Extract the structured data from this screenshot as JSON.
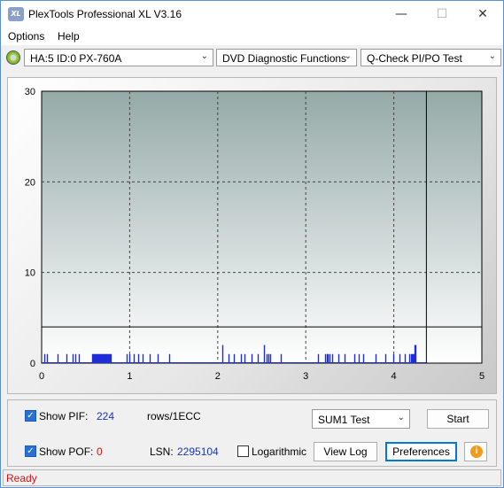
{
  "window": {
    "title": "PlexTools Professional XL V3.16",
    "icon_text": "XL",
    "minimize_glyph": "—",
    "maximize_glyph": "☐",
    "close_glyph": "✕"
  },
  "menu": {
    "items": [
      {
        "label": "Options"
      },
      {
        "label": "Help"
      }
    ]
  },
  "toolbar": {
    "drive": "HA:5 ID:0  PX-760A",
    "function": "DVD Diagnostic Functions",
    "test": "Q-Check PI/PO Test"
  },
  "chart_data": {
    "type": "bar",
    "x_ticks": [
      "0",
      "1",
      "2",
      "3",
      "4",
      "5"
    ],
    "y_ticks": [
      "0",
      "10",
      "20",
      "30"
    ],
    "xlim": [
      0,
      5
    ],
    "ylim": [
      0,
      30
    ],
    "grid": true,
    "threshold_line": 4,
    "end_marker": 4.37,
    "colors": {
      "bars": "#1f2fd6",
      "threshold": "#000000"
    },
    "x": [
      0.03,
      0.06,
      0.18,
      0.28,
      0.35,
      0.38,
      0.42,
      0.57,
      0.58,
      0.59,
      0.6,
      0.61,
      0.62,
      0.63,
      0.64,
      0.65,
      0.66,
      0.67,
      0.68,
      0.69,
      0.7,
      0.71,
      0.72,
      0.73,
      0.74,
      0.75,
      0.76,
      0.77,
      0.78,
      0.97,
      1.0,
      1.05,
      1.1,
      1.15,
      1.23,
      1.32,
      1.45,
      2.05,
      2.12,
      2.18,
      2.26,
      2.3,
      2.38,
      2.45,
      2.53,
      2.56,
      2.58,
      2.6,
      2.72,
      3.14,
      3.22,
      3.24,
      3.25,
      3.27,
      3.3,
      3.37,
      3.44,
      3.55,
      3.6,
      3.65,
      3.79,
      3.9,
      3.99,
      4.06,
      4.12,
      4.18,
      4.2,
      4.21,
      4.22,
      4.23,
      4.24,
      4.25
    ],
    "values": [
      1,
      1,
      1,
      1,
      1,
      1,
      1,
      1,
      1,
      1,
      1,
      1,
      1,
      1,
      1,
      1,
      1,
      1,
      1,
      1,
      1,
      1,
      1,
      1,
      1,
      1,
      1,
      1,
      1,
      1,
      1,
      1,
      1,
      1,
      1,
      1,
      1,
      2,
      1,
      1,
      1,
      1,
      1,
      1,
      2,
      1,
      1,
      1,
      1,
      1,
      1,
      1,
      1,
      1,
      1,
      1,
      1,
      1,
      1,
      1,
      1,
      1,
      1,
      1,
      1,
      1,
      1,
      1,
      1,
      1,
      2,
      2
    ]
  },
  "controls": {
    "show_pif_label": "Show PIF:",
    "pif_value": "224",
    "pif_unit": "rows/1ECC",
    "show_pof_label": "Show POF:",
    "pof_value": "0",
    "lsn_label": "LSN:",
    "lsn_value": "2295104",
    "logarithmic_label": "Logarithmic",
    "sum_select": "SUM1 Test",
    "start_label": "Start",
    "view_log_label": "View Log",
    "preferences_label": "Preferences",
    "info_glyph": "i"
  },
  "status": {
    "text": "Ready"
  }
}
